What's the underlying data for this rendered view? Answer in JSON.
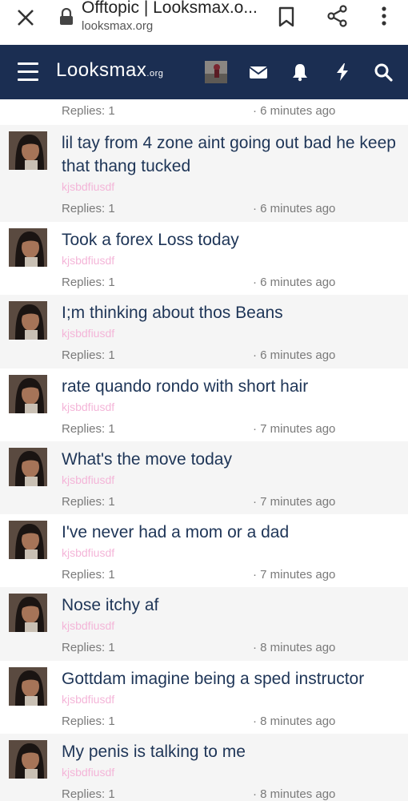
{
  "browser": {
    "title": "Offtopic | Looksmax.o...",
    "url": "looksmax.org"
  },
  "site": {
    "logo": "Looksmax",
    "logo_suffix": ".org"
  },
  "partial_row": {
    "replies": "Replies: 1",
    "time": "· 6 minutes ago"
  },
  "threads": [
    {
      "title": "lil tay from 4 zone aint going out bad he keep that thang tucked",
      "author": "kjsbdfiusdf",
      "replies": "Replies: 1",
      "time": "· 6 minutes ago"
    },
    {
      "title": "Took a forex Loss today",
      "author": "kjsbdfiusdf",
      "replies": "Replies: 1",
      "time": "· 6 minutes ago"
    },
    {
      "title": "I;m thinking about thos Beans",
      "author": "kjsbdfiusdf",
      "replies": "Replies: 1",
      "time": "· 6 minutes ago"
    },
    {
      "title": "rate quando rondo with short hair",
      "author": "kjsbdfiusdf",
      "replies": "Replies: 1",
      "time": "· 7 minutes ago"
    },
    {
      "title": "What's the move today",
      "author": "kjsbdfiusdf",
      "replies": "Replies: 1",
      "time": "· 7 minutes ago"
    },
    {
      "title": "I've never had a mom or a dad",
      "author": "kjsbdfiusdf",
      "replies": "Replies: 1",
      "time": "· 7 minutes ago"
    },
    {
      "title": "Nose itchy af",
      "author": "kjsbdfiusdf",
      "replies": "Replies: 1",
      "time": "· 8 minutes ago"
    },
    {
      "title": "Gottdam imagine being a sped instructor",
      "author": "kjsbdfiusdf",
      "replies": "Replies: 1",
      "time": "· 8 minutes ago"
    },
    {
      "title": "My penis is talking to me",
      "author": "kjsbdfiusdf",
      "replies": "Replies: 1",
      "time": "· 8 minutes ago"
    }
  ],
  "colors": {
    "header_bg": "#1b2e52",
    "title_color": "#1e3557",
    "author_color": "#f4b5d8",
    "row_alt_bg": "#f5f5f5"
  }
}
